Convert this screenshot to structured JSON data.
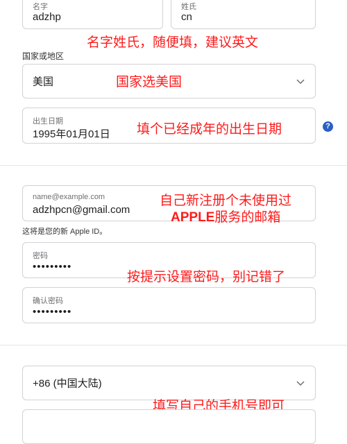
{
  "form": {
    "first_name": {
      "label": "名字",
      "value": "adzhp"
    },
    "last_name": {
      "label": "姓氏",
      "value": "cn"
    },
    "country": {
      "label": "国家或地区",
      "value": "美国"
    },
    "birthday": {
      "label": "出生日期",
      "value": "1995年01月01日",
      "help": "?"
    },
    "email": {
      "label": "name@example.com",
      "value": "adzhpcn@gmail.com",
      "note": "这将是您的新 Apple ID。"
    },
    "password": {
      "label": "密码",
      "value": "•••••••••"
    },
    "confirm_password": {
      "label": "确认密码",
      "value": "•••••••••"
    },
    "phone_region": {
      "value": "+86 (中国大陆)"
    }
  },
  "annotations": {
    "name": "名字姓氏，随便填，建议英文",
    "country": "国家选美国",
    "birthday": "填个已经成年的出生日期",
    "email_line1": "自己新注册个未使用过",
    "email_apple": "APPLE",
    "email_line2_rest": "服务的邮箱",
    "password": "按提示设置密码，别记错了",
    "phone": "填写自己的手机号即可"
  },
  "colors": {
    "annotation": "#ff1a1a",
    "help_icon": "#2b5fc4",
    "border": "#d2d2d7"
  }
}
